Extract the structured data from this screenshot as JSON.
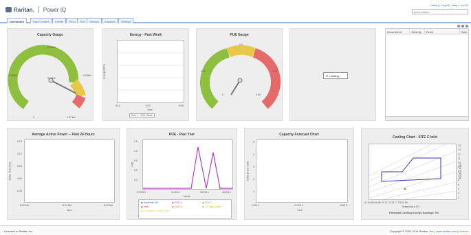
{
  "header": {
    "brand": "Raritan.",
    "product": "Power IQ",
    "links": [
      "raritan",
      "Logoff",
      "Help",
      "en-US"
    ],
    "search_placeholder": "quick search"
  },
  "tabs": [
    "Dashboard",
    "Data Centers",
    "Events",
    "PDUs",
    "PUE",
    "Devices",
    "Analytics",
    "Settings"
  ],
  "capacity": {
    "title": "Capacity Gauge",
    "top": "0.03kW",
    "left": "0.00kW",
    "right": "0.05kW",
    "current": "0.04kW",
    "min": "0",
    "max": "0.07 kW",
    "value_fraction": 0.62
  },
  "energy": {
    "title": "Energy - Past Week",
    "ylabel": "Energy (kWh)",
    "xlabel": "Time",
    "xticks": [
      "6/12",
      "6/15",
      "6/18"
    ],
    "yticks": [
      "0",
      "1",
      "2",
      "3",
      "4",
      "5"
    ],
    "legend": "Row 1 - 0.00 (Total)"
  },
  "pue_gauge": {
    "title": "PUE Gauge",
    "top": "2.5",
    "left": "1.25",
    "right": "3.75",
    "min": "0",
    "max": "5.00",
    "value_fraction": 0.33
  },
  "loading": {
    "text": "Loading..."
  },
  "events": {
    "columns": [
      "Occurred at",
      "Severity",
      "Event",
      "Sum"
    ]
  },
  "active_power": {
    "title": "Average Active Power -- Past 24 Hours",
    "ylabel": "Active Power (W)",
    "xlabel": "Hour",
    "yticks": [
      "0.15",
      "0.12",
      "0.09",
      "0.06",
      "0.03",
      "0"
    ],
    "xticks": [
      "8:00 AM",
      "8:00 PM",
      "8:00 AM"
    ]
  },
  "pue_year": {
    "title": "PUE - Past Year",
    "ylabel": "PUE",
    "xlabel": "Month",
    "yticks": [
      "1.5",
      "1.2",
      "0.9",
      "0.6",
      "0.3",
      "0"
    ],
    "xticks": [
      "07/2013",
      "11/2013",
      "02/2014",
      "06/2014"
    ],
    "legend": [
      "Somerset, NJ",
      "SITE A",
      "SITE C",
      "Test1",
      "Test DC",
      "TC Data Center",
      "Unassigned Data Center"
    ]
  },
  "forecast": {
    "title": "Capacity Forecast Chart",
    "ylabel": "Active Power (kW)",
    "xlabel": "Time",
    "yticks": [
      "5",
      "4",
      "3",
      "2",
      "1",
      "0"
    ],
    "xticks": [
      "7/2014",
      "11/2014",
      "4/2015"
    ]
  },
  "cooling": {
    "title": "Cooling Chart - SITE C Inlet",
    "xlabel": "Temperature (°F)",
    "ylabel": "Moisture Ratio",
    "xticks": [
      "61",
      "63",
      "65",
      "66",
      "68",
      "70",
      "72",
      "73",
      "75",
      "77",
      "79",
      "81",
      "83"
    ],
    "yticks": [
      "14",
      "13",
      "12",
      "11",
      "10",
      "9",
      "8",
      "7",
      "6",
      "5",
      "4",
      "3",
      "2"
    ],
    "savings": "Potential Cooling Energy Savings: 0%"
  },
  "footer": {
    "left": "Licensed to Raritan Inc.",
    "right": "Copyright © 2007-2014 Raritan, Inc. |",
    "link1": "www.raritan.com",
    "link2": "License"
  },
  "chart_data": [
    {
      "type": "line",
      "title": "PUE - Past Year",
      "categories": [
        "07/2013",
        "11/2013",
        "02/2014",
        "06/2014"
      ],
      "series": [
        {
          "name": "SITE A",
          "values": [
            0,
            0,
            0,
            1.3,
            0,
            1.2,
            0,
            0
          ]
        },
        {
          "name": "SITE C",
          "values": [
            0,
            0,
            0,
            0,
            0,
            0,
            0,
            0
          ]
        }
      ],
      "ylim": [
        0,
        1.5
      ]
    }
  ]
}
